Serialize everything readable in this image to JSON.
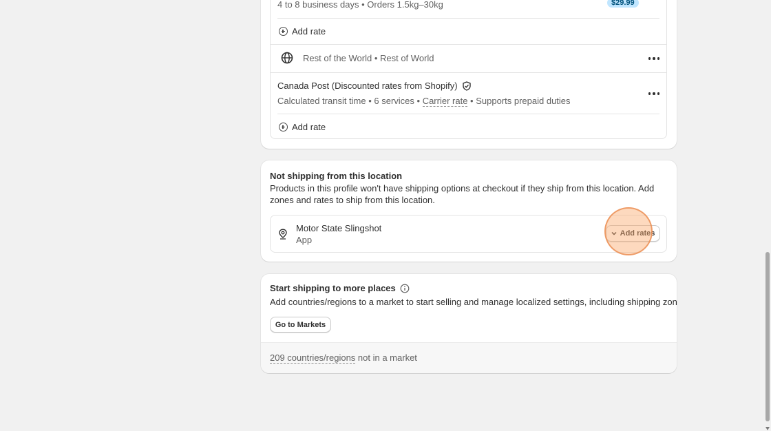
{
  "shipping_zone_card": {
    "top_rate_details": "4 to 8 business days • Orders 1.5kg–30kg",
    "top_rate_price": "$29.99",
    "add_rate_label_1": "Add rate",
    "zone_name": "Rest of the World",
    "zone_separator": " • ",
    "zone_region": "Rest of World",
    "carrier_name": "Canada Post (Discounted rates from Shopify)",
    "carrier_detail_prefix": "Calculated transit time • 6 services • ",
    "carrier_rate_link": "Carrier rate",
    "carrier_detail_suffix": " • Supports prepaid duties",
    "add_rate_label_2": "Add rate"
  },
  "not_shipping_card": {
    "title": "Not shipping from this location",
    "description": "Products in this profile won't have shipping options at checkout if they ship from this location. Add zones and rates to ship from this location.",
    "location_name": "Motor State Slingshot",
    "location_type": "App",
    "add_rates_label": "Add rates"
  },
  "markets_card": {
    "title": "Start shipping to more places",
    "description": "Add countries/regions to a market to start selling and manage localized settings, including shipping zones",
    "button_label": "Go to Markets",
    "footer_link": "209 countries/regions",
    "footer_suffix": " not in a market"
  },
  "colors": {
    "page_bg": "#f1f1f1",
    "card_bg": "#ffffff",
    "badge_bg": "#c0e6ff",
    "focus_ring": "#eb8c50"
  },
  "icons": [
    "circle-plus-icon",
    "globe-icon",
    "more-horizontal-icon",
    "verified-shield-icon",
    "location-pin-icon",
    "chevron-down-icon",
    "info-icon"
  ]
}
